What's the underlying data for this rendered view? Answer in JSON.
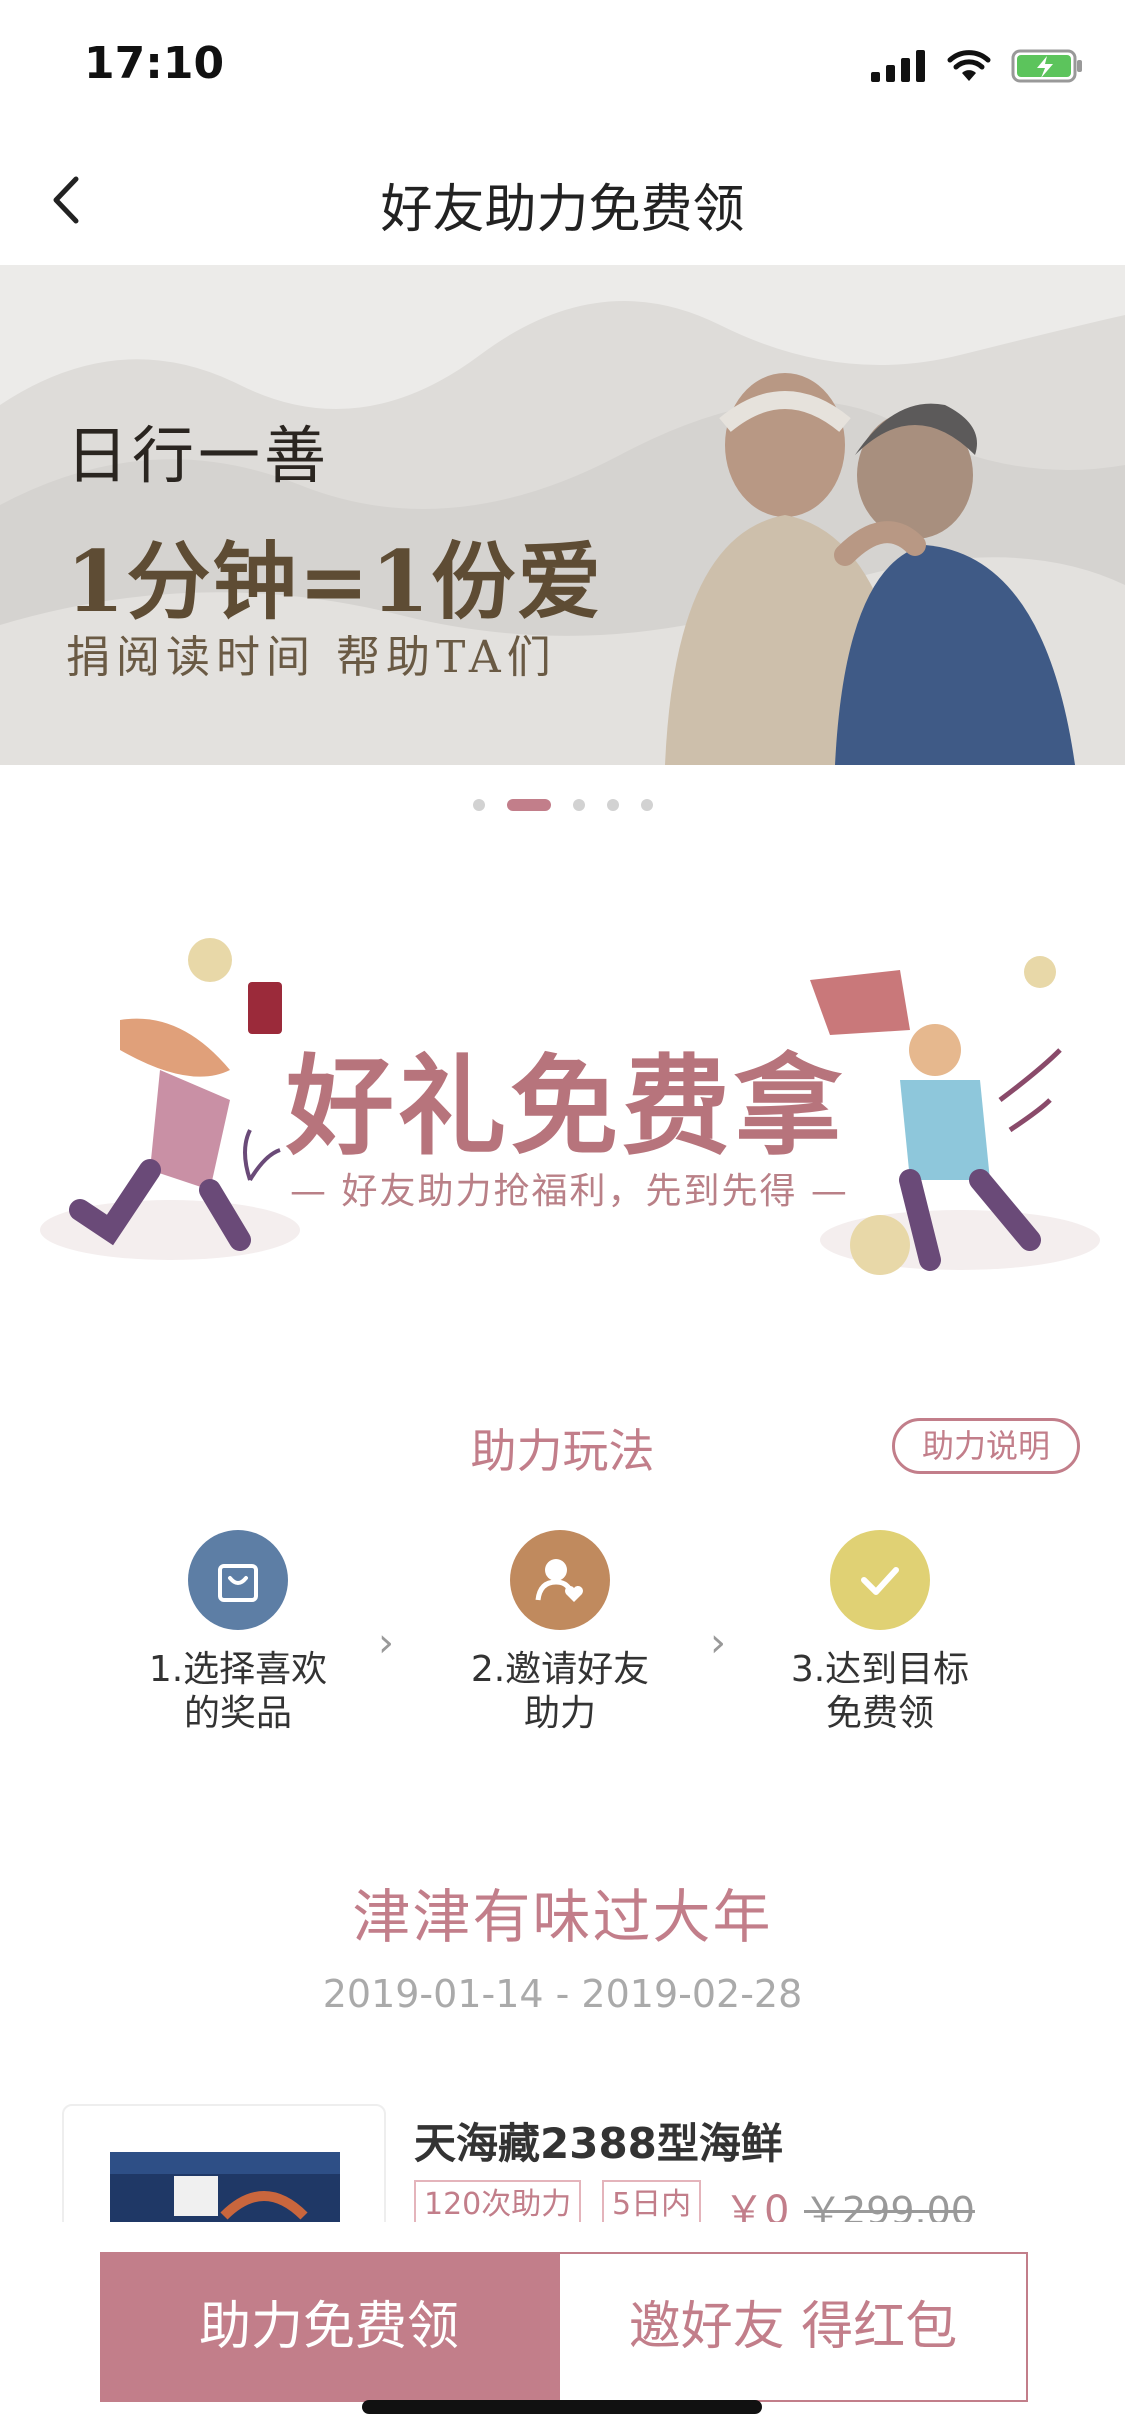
{
  "status_bar": {
    "time": "17:10"
  },
  "nav": {
    "title": "好友助力免费领"
  },
  "banner": {
    "slogan_top": "日行一善",
    "headline": "1分钟=1份爱",
    "subline": "捐阅读时间 帮助TA们",
    "page_count": 5,
    "active_index": 1
  },
  "promo": {
    "title": "好礼免费拿",
    "subtitle": "— 好友助力抢福利，先到先得 —"
  },
  "howto": {
    "title": "助力玩法",
    "help_button": "助力说明",
    "steps": [
      {
        "line1": "1.选择喜欢",
        "line2": "的奖品",
        "icon": "shopping-bag-icon",
        "color": "#5d7ea5"
      },
      {
        "line1": "2.邀请好友",
        "line2": "助力",
        "icon": "user-heart-icon",
        "color": "#c08a5e"
      },
      {
        "line1": "3.达到目标",
        "line2": "免费领",
        "icon": "check-icon",
        "color": "#e0d174"
      }
    ]
  },
  "event": {
    "title": "津津有味过大年",
    "dates": "2019-01-14 - 2019-02-28"
  },
  "product": {
    "name": "天海藏2388型海鲜",
    "tag_boosts": "120次助力",
    "tag_days": "5日内",
    "price": "￥0",
    "original_price": "￥299.00"
  },
  "bottom": {
    "claim_label": "助力免费领",
    "invite_label": "邀好友 得红包"
  },
  "colors": {
    "accent": "#c27e8a"
  }
}
